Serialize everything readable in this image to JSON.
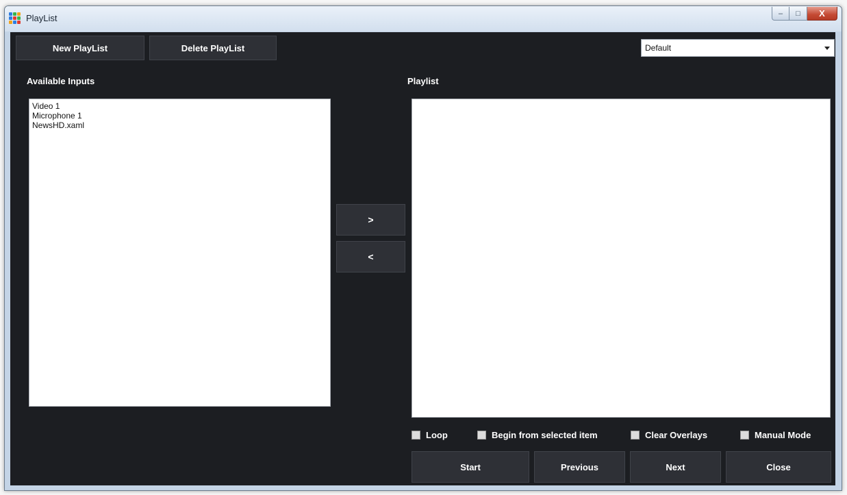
{
  "window": {
    "title": "PlayList",
    "controls": {
      "minimize": "–",
      "maximize": "□",
      "close": "X"
    }
  },
  "toolbar": {
    "new_playlist": "New PlayList",
    "delete_playlist": "Delete PlayList",
    "playlist_select": {
      "selected": "Default"
    }
  },
  "available": {
    "label": "Available Inputs",
    "items": [
      "Video 1",
      "Microphone 1",
      "NewsHD.xaml"
    ]
  },
  "transfer": {
    "add": ">",
    "remove": "<"
  },
  "playlist": {
    "label": "Playlist",
    "items": []
  },
  "options": {
    "loop": "Loop",
    "begin_selected": "Begin from selected item",
    "clear_overlays": "Clear Overlays",
    "manual_mode": "Manual Mode"
  },
  "actions": {
    "start": "Start",
    "previous": "Previous",
    "next": "Next",
    "close": "Close"
  },
  "colors": {
    "client_bg": "#1c1e22",
    "button_bg": "#2e3036",
    "text": "#ffffff",
    "icon_colors": [
      "#2f7de1",
      "#3ab44a",
      "#f2a31b",
      "#2f7de1",
      "#e23b2e",
      "#3ab44a",
      "#f2a31b",
      "#2f7de1",
      "#e23b2e"
    ]
  }
}
